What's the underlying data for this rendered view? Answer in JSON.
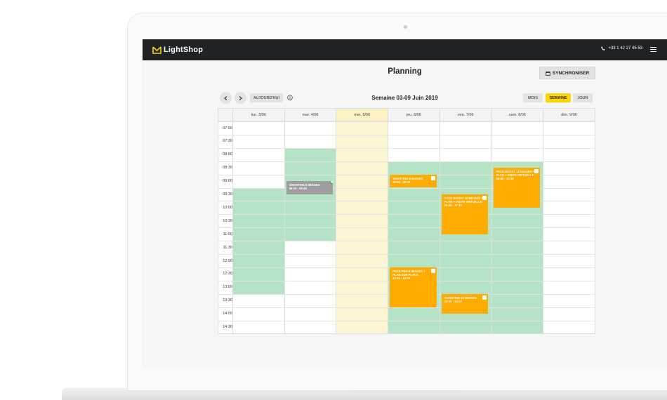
{
  "header": {
    "logo_text": "LightShop",
    "phone": "+33 1 42 27 45 53"
  },
  "page": {
    "title": "Planning",
    "sync_label": "SYNCHRONISER"
  },
  "toolbar": {
    "today_label": "AUJOURD'HUI",
    "week_title": "Semaine 03-09 Juin 2019",
    "views": [
      "MOIS",
      "SEMAINE",
      "JOUR"
    ],
    "active_view": "SEMAINE"
  },
  "calendar": {
    "days": [
      "lun. 3/06",
      "mar. 4/06",
      "mer. 5/06",
      "jeu. 6/06",
      "ven. 7/06",
      "sam. 8/06",
      "dim. 9/06"
    ],
    "today_index": 2,
    "times": [
      "07:00",
      "07:30",
      "08:00",
      "08:30",
      "09:00",
      "09:30",
      "10:00",
      "10:30",
      "11:00",
      "11:30",
      "12:00",
      "12:30",
      "13:00",
      "13:30",
      "14:00",
      "14:30"
    ],
    "events": [
      {
        "day": 1,
        "title": "SHOOTING 8 IMAGES",
        "time": "09:15 - 09:45",
        "color": "gray"
      },
      {
        "day": 3,
        "title": "SHOOTING 8 IMAGES",
        "time": "09:00 - 09:30",
        "color": "orange"
      },
      {
        "day": 3,
        "title": "PACK PRO 8 IMAGES + PLAN SUR PLACE",
        "time": "12:30 - 14:00",
        "color": "orange"
      },
      {
        "day": 4,
        "title": "PACK BOOST 12 IMAGES + PLAN + VISITE VIRTUELLE",
        "time": "09:45 - 11:15",
        "color": "orange"
      },
      {
        "day": 4,
        "title": "SHOOTING 12 IMAGES",
        "time": "13:30 - 14:15",
        "color": "orange"
      },
      {
        "day": 5,
        "title": "PACK BOOST 12 IMAGES + PLAN + VISITE VIRTUELLE",
        "time": "08:45 - 10:15",
        "color": "orange"
      }
    ]
  },
  "colors": {
    "accent": "#ffd400",
    "event": "#ffab00",
    "available": "#b4e3c5",
    "topbar": "#1f2325"
  }
}
